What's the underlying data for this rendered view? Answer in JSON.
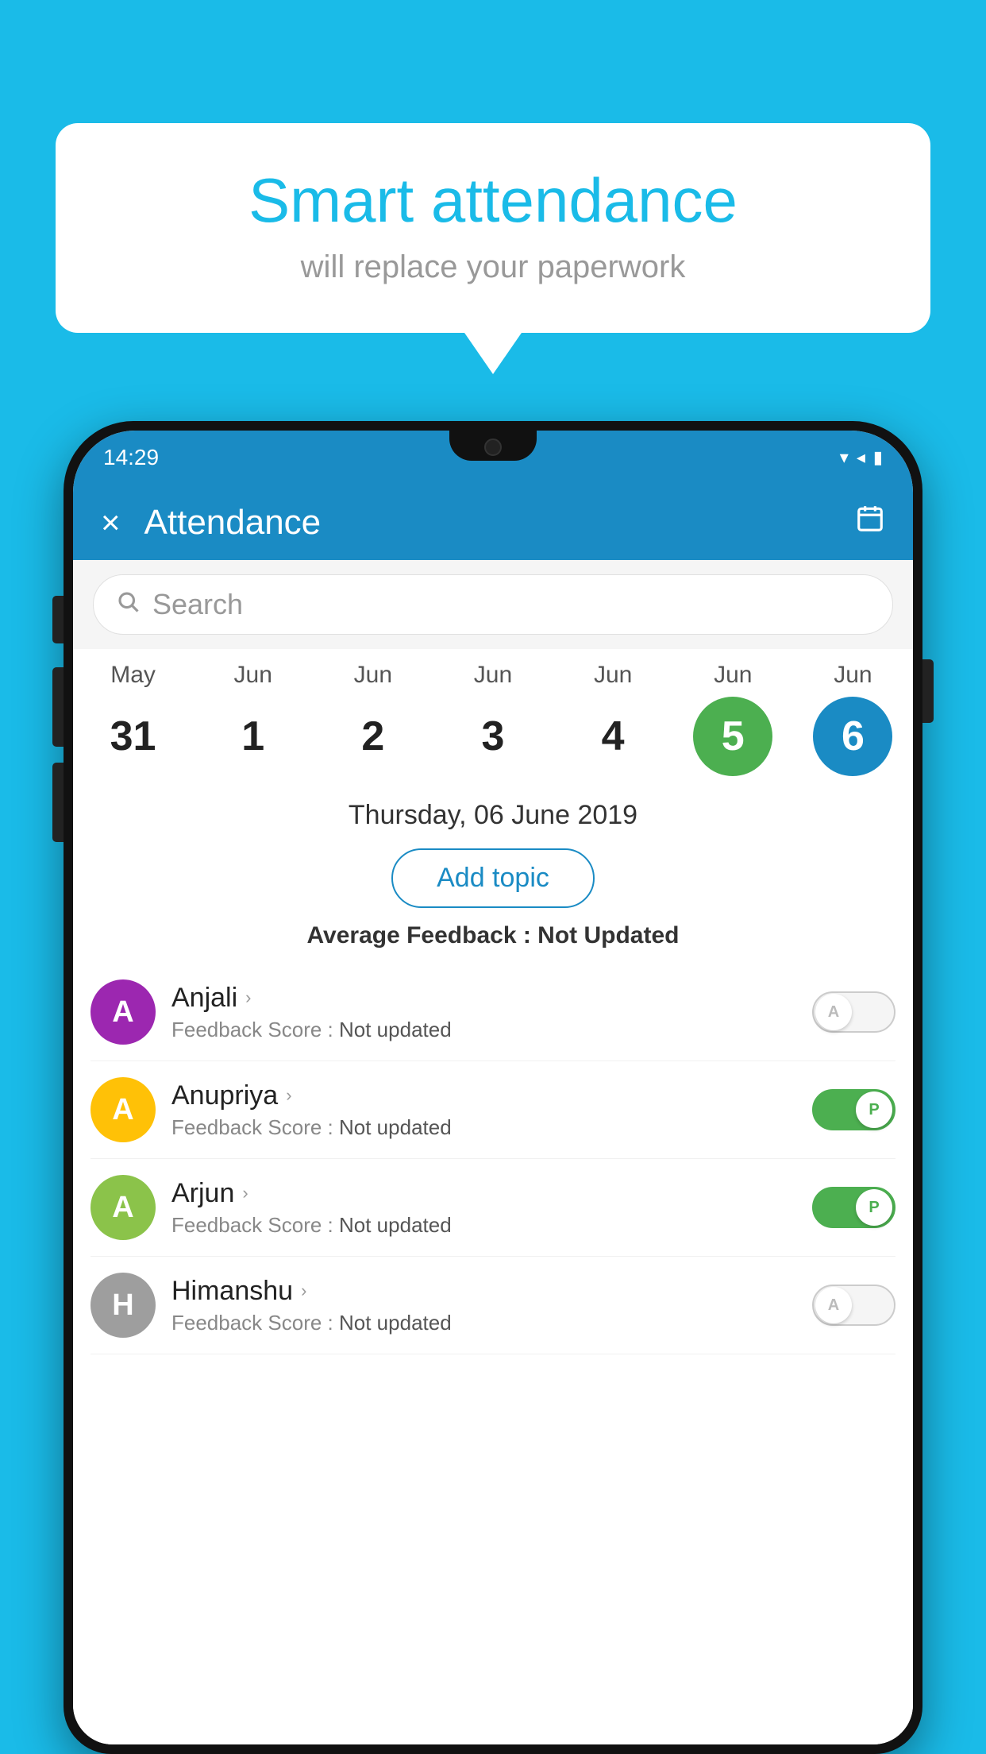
{
  "background_color": "#1ABBE8",
  "speech_bubble": {
    "title": "Smart attendance",
    "subtitle": "will replace your paperwork"
  },
  "status_bar": {
    "time": "14:29",
    "icons": [
      "wifi",
      "signal",
      "battery"
    ]
  },
  "app_header": {
    "title": "Attendance",
    "close_label": "×",
    "calendar_icon": "📅"
  },
  "search": {
    "placeholder": "Search"
  },
  "dates": [
    {
      "month": "May",
      "day": "31",
      "style": "normal"
    },
    {
      "month": "Jun",
      "day": "1",
      "style": "normal"
    },
    {
      "month": "Jun",
      "day": "2",
      "style": "normal"
    },
    {
      "month": "Jun",
      "day": "3",
      "style": "normal"
    },
    {
      "month": "Jun",
      "day": "4",
      "style": "normal"
    },
    {
      "month": "Jun",
      "day": "5",
      "style": "today"
    },
    {
      "month": "Jun",
      "day": "6",
      "style": "selected"
    }
  ],
  "selected_date_label": "Thursday, 06 June 2019",
  "add_topic_label": "Add topic",
  "feedback_summary": {
    "label": "Average Feedback : ",
    "value": "Not Updated"
  },
  "students": [
    {
      "name": "Anjali",
      "avatar_letter": "A",
      "avatar_color": "#9C27B0",
      "feedback_label": "Feedback Score : ",
      "feedback_value": "Not updated",
      "toggle_state": "off",
      "toggle_letter": "A"
    },
    {
      "name": "Anupriya",
      "avatar_letter": "A",
      "avatar_color": "#FFC107",
      "feedback_label": "Feedback Score : ",
      "feedback_value": "Not updated",
      "toggle_state": "on",
      "toggle_letter": "P"
    },
    {
      "name": "Arjun",
      "avatar_letter": "A",
      "avatar_color": "#8BC34A",
      "feedback_label": "Feedback Score : ",
      "feedback_value": "Not updated",
      "toggle_state": "on",
      "toggle_letter": "P"
    },
    {
      "name": "Himanshu",
      "avatar_letter": "H",
      "avatar_color": "#9E9E9E",
      "feedback_label": "Feedback Score : ",
      "feedback_value": "Not updated",
      "toggle_state": "off",
      "toggle_letter": "A"
    }
  ]
}
